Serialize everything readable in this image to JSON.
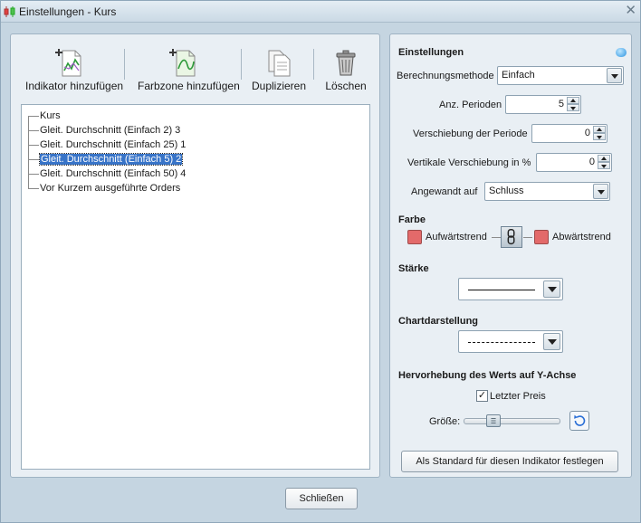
{
  "window": {
    "title": "Einstellungen - Kurs",
    "close_icon": "close-icon"
  },
  "toolbar": {
    "add_indicator_label": "Indikator hinzufügen",
    "add_colorzone_label": "Farbzone hinzufügen",
    "duplicate_label": "Duplizieren",
    "delete_label": "Löschen"
  },
  "tree": {
    "items": [
      "Kurs",
      "Gleit. Durchschnitt (Einfach 2) 3",
      "Gleit. Durchschnitt (Einfach 25) 1",
      "Gleit. Durchschnitt (Einfach 5) 2",
      "Gleit. Durchschnitt (Einfach 50) 4",
      "Vor Kurzem ausgeführte Orders"
    ],
    "selected_index": 3
  },
  "settings": {
    "heading": "Einstellungen",
    "method_label": "Berechnungsmethode",
    "method_value": "Einfach",
    "periods_label": "Anz. Perioden",
    "periods_value": "5",
    "shift_label": "Verschiebung der Periode",
    "shift_value": "0",
    "vshift_label": "Vertikale Verschiebung in %",
    "vshift_value": "0",
    "applied_label": "Angewandt auf",
    "applied_value": "Schluss",
    "color_heading": "Farbe",
    "uptrend_label": "Aufwärtstrend",
    "downtrend_label": "Abwärtstrend",
    "uptrend_color": "#e36a6a",
    "downtrend_color": "#e36a6a",
    "strength_heading": "Stärke",
    "chartstyle_heading": "Chartdarstellung",
    "highlight_heading": "Hervorhebung des Werts auf Y-Achse",
    "last_price_label": "Letzter Preis",
    "last_price_checked": true,
    "size_label": "Größe:",
    "set_default_label": "Als Standard für diesen Indikator festlegen"
  },
  "footer": {
    "close_label": "Schließen"
  }
}
